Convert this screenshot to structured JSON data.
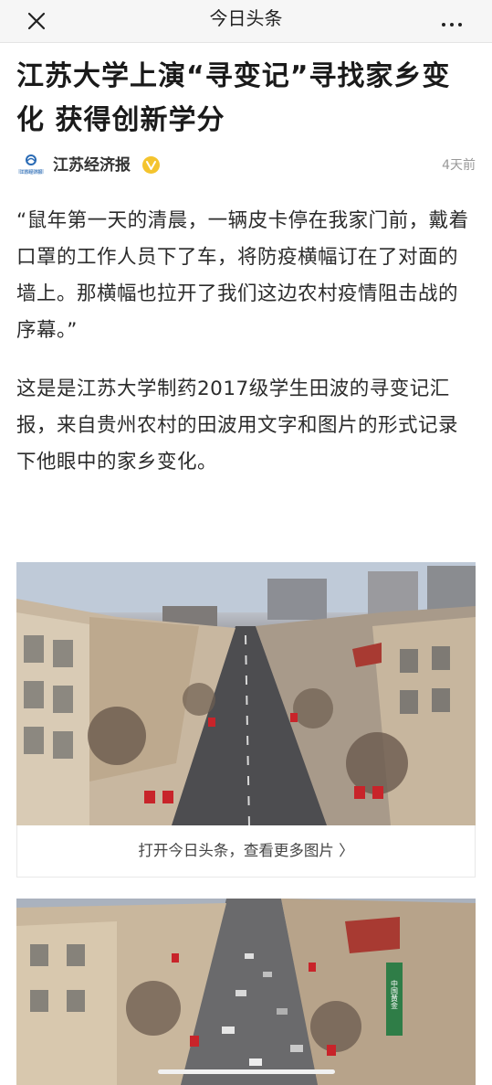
{
  "topbar": {
    "title": "今日头条",
    "close_icon": "close-icon",
    "more_icon": "more-icon"
  },
  "article": {
    "headline": "江苏大学上演“寻变记”寻找家乡变化 获得创新学分",
    "source": {
      "name": "江苏经济报",
      "logo_text": "江苏经济报",
      "verified_icon": "verified-badge-icon",
      "time": "4天前"
    },
    "paragraphs": [
      "“鼠年第一天的清晨，一辆皮卡停在我家门前，戴着口罩的工作人员下了车，将防疫横幅订在了对面的墙上。那横幅也拉开了我们这边农村疫情阻击战的序幕。”",
      "这是是江苏大学制药2017级学生田波的寻变记汇报，来自贵州农村的田波用文字和图片的形式记录下他眼中的家乡变化。"
    ],
    "image_caption": "打开今日头条，查看更多图片 〉",
    "photo2_sign": "中国黄金"
  },
  "colors": {
    "topbar_bg": "#f6f6f6",
    "verified_badge": "#f4c42e",
    "text_primary": "#1a1a1a",
    "text_muted": "#999999"
  }
}
